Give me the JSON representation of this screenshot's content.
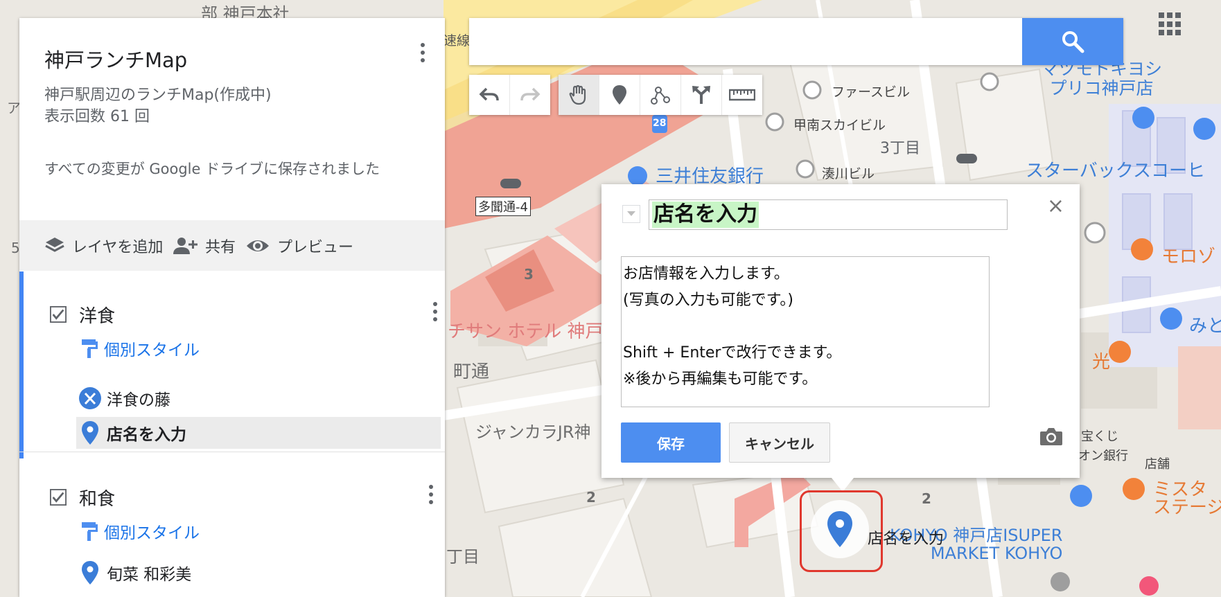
{
  "map": {
    "labels": {
      "kobe_honsha": "部 神戸本社",
      "sokusen": "速線",
      "farce_bldg": "ファースビル",
      "konan_sky": "甲南スカイビル",
      "sanchome": "3丁目",
      "mitsui": "三井住友銀行",
      "minatogawa": "湊川ビル",
      "tamon": "多聞通-4",
      "route28": "28",
      "matsumoto": "マツモトキヨシ\nプリコ神戸店",
      "starbucks": "スターバックスコーヒ",
      "moroz": "モロゾ",
      "mito": "みと",
      "hikari": "光",
      "takarakuji": "宝くじ",
      "aeon_bank": "オン銀行",
      "tenpo": "店舗",
      "mister": "ミスタ",
      "stage": "ステージ",
      "hotel": "チサン ホテル 神戸",
      "machidori": "町通",
      "jankara": "ジャンカラJR神",
      "kohyo": "KOHYO 神戸店ISUPER\nMARKET KOHYO",
      "chome": "丁目",
      "num2a": "2",
      "num2b": "2",
      "num3": "3",
      "left_a": "ア",
      "left_5": "5"
    }
  },
  "panel": {
    "title": "神戸ランチMap",
    "description": "神戸駅周辺のランチMap(作成中)",
    "views": "表示回数 61 回",
    "save_status": "すべての変更が Google ドライブに保存されました",
    "actions": {
      "add_layer": "レイヤを追加",
      "share": "共有",
      "preview": "プレビュー"
    },
    "layers": [
      {
        "name": "洋食",
        "style": "個別スタイル",
        "items": [
          "洋食の藤",
          "店名を入力"
        ]
      },
      {
        "name": "和食",
        "style": "個別スタイル",
        "items": [
          "旬菜 和彩美"
        ]
      }
    ]
  },
  "search": {
    "value": "",
    "placeholder": ""
  },
  "toolbar": {
    "icons": [
      "undo-icon",
      "redo-icon",
      "hand-icon",
      "marker-icon",
      "line-icon",
      "directions-icon",
      "ruler-icon"
    ]
  },
  "info_window": {
    "name": "店名を入力",
    "description": "お店情報を入力します。\n(写真の入力も可能です。)\n\nShift + Enterで改行できます。\n※後から再編集も可能です。",
    "save": "保存",
    "cancel": "キャンセル",
    "close": "×"
  },
  "marker_label": "店名を入力",
  "colors": {
    "accent": "#4d8ef0",
    "marker": "#3b7dd8",
    "highlight": "#e0382e",
    "link": "#1a73e8"
  }
}
